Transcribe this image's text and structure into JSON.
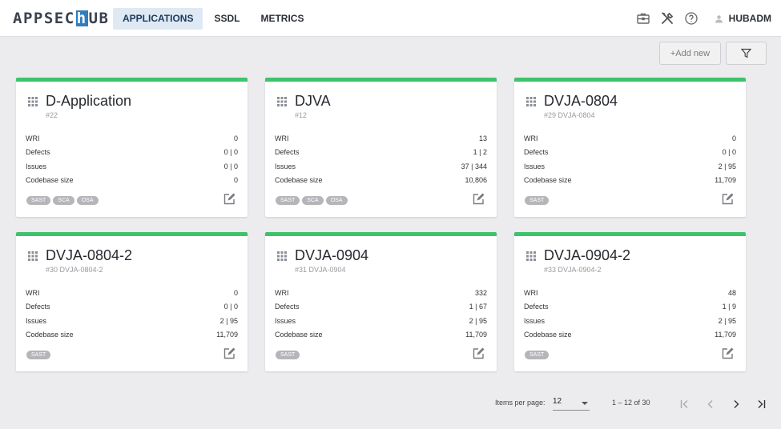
{
  "header": {
    "logo_prefix": "APPSEC",
    "logo_h": "h",
    "logo_suffix": "UB",
    "nav": [
      "APPLICATIONS",
      "SSDL",
      "METRICS"
    ],
    "user": "HUBADM"
  },
  "toolbar": {
    "add_label": "+Add new"
  },
  "metric_labels": [
    "WRI",
    "Defects",
    "Issues",
    "Codebase size"
  ],
  "cards": [
    {
      "title": "D-Application",
      "sub": "#22",
      "wri": "0",
      "defects": "0 | 0",
      "issues": "0 | 0",
      "codebase": "0",
      "tags": [
        "SAST",
        "SCA",
        "OSA"
      ]
    },
    {
      "title": "DJVA",
      "sub": "#12",
      "wri": "13",
      "defects": "1 | 2",
      "issues": "37 | 344",
      "codebase": "10,806",
      "tags": [
        "SAST",
        "SCA",
        "OSA"
      ]
    },
    {
      "title": "DVJA-0804",
      "sub": "#29 DVJA-0804",
      "wri": "0",
      "defects": "0 | 0",
      "issues": "2 | 95",
      "codebase": "11,709",
      "tags": [
        "SAST"
      ]
    },
    {
      "title": "DVJA-0804-2",
      "sub": "#30 DVJA-0804-2",
      "wri": "0",
      "defects": "0 | 0",
      "issues": "2 | 95",
      "codebase": "11,709",
      "tags": [
        "SAST"
      ]
    },
    {
      "title": "DVJA-0904",
      "sub": "#31 DVJA-0904",
      "wri": "332",
      "defects": "1 | 67",
      "issues": "2 | 95",
      "codebase": "11,709",
      "tags": [
        "SAST"
      ]
    },
    {
      "title": "DVJA-0904-2",
      "sub": "#33 DVJA-0904-2",
      "wri": "48",
      "defects": "1 | 9",
      "issues": "2 | 95",
      "codebase": "11,709",
      "tags": [
        "SAST"
      ]
    }
  ],
  "pager": {
    "items_per_page_label": "Items per page:",
    "items_per_page_value": "12",
    "range": "1 – 12 of 30"
  },
  "colors": {
    "accent": "#3ec36b",
    "nav_active_bg": "#dfe9f4",
    "logo_blue": "#2f7fc0"
  }
}
